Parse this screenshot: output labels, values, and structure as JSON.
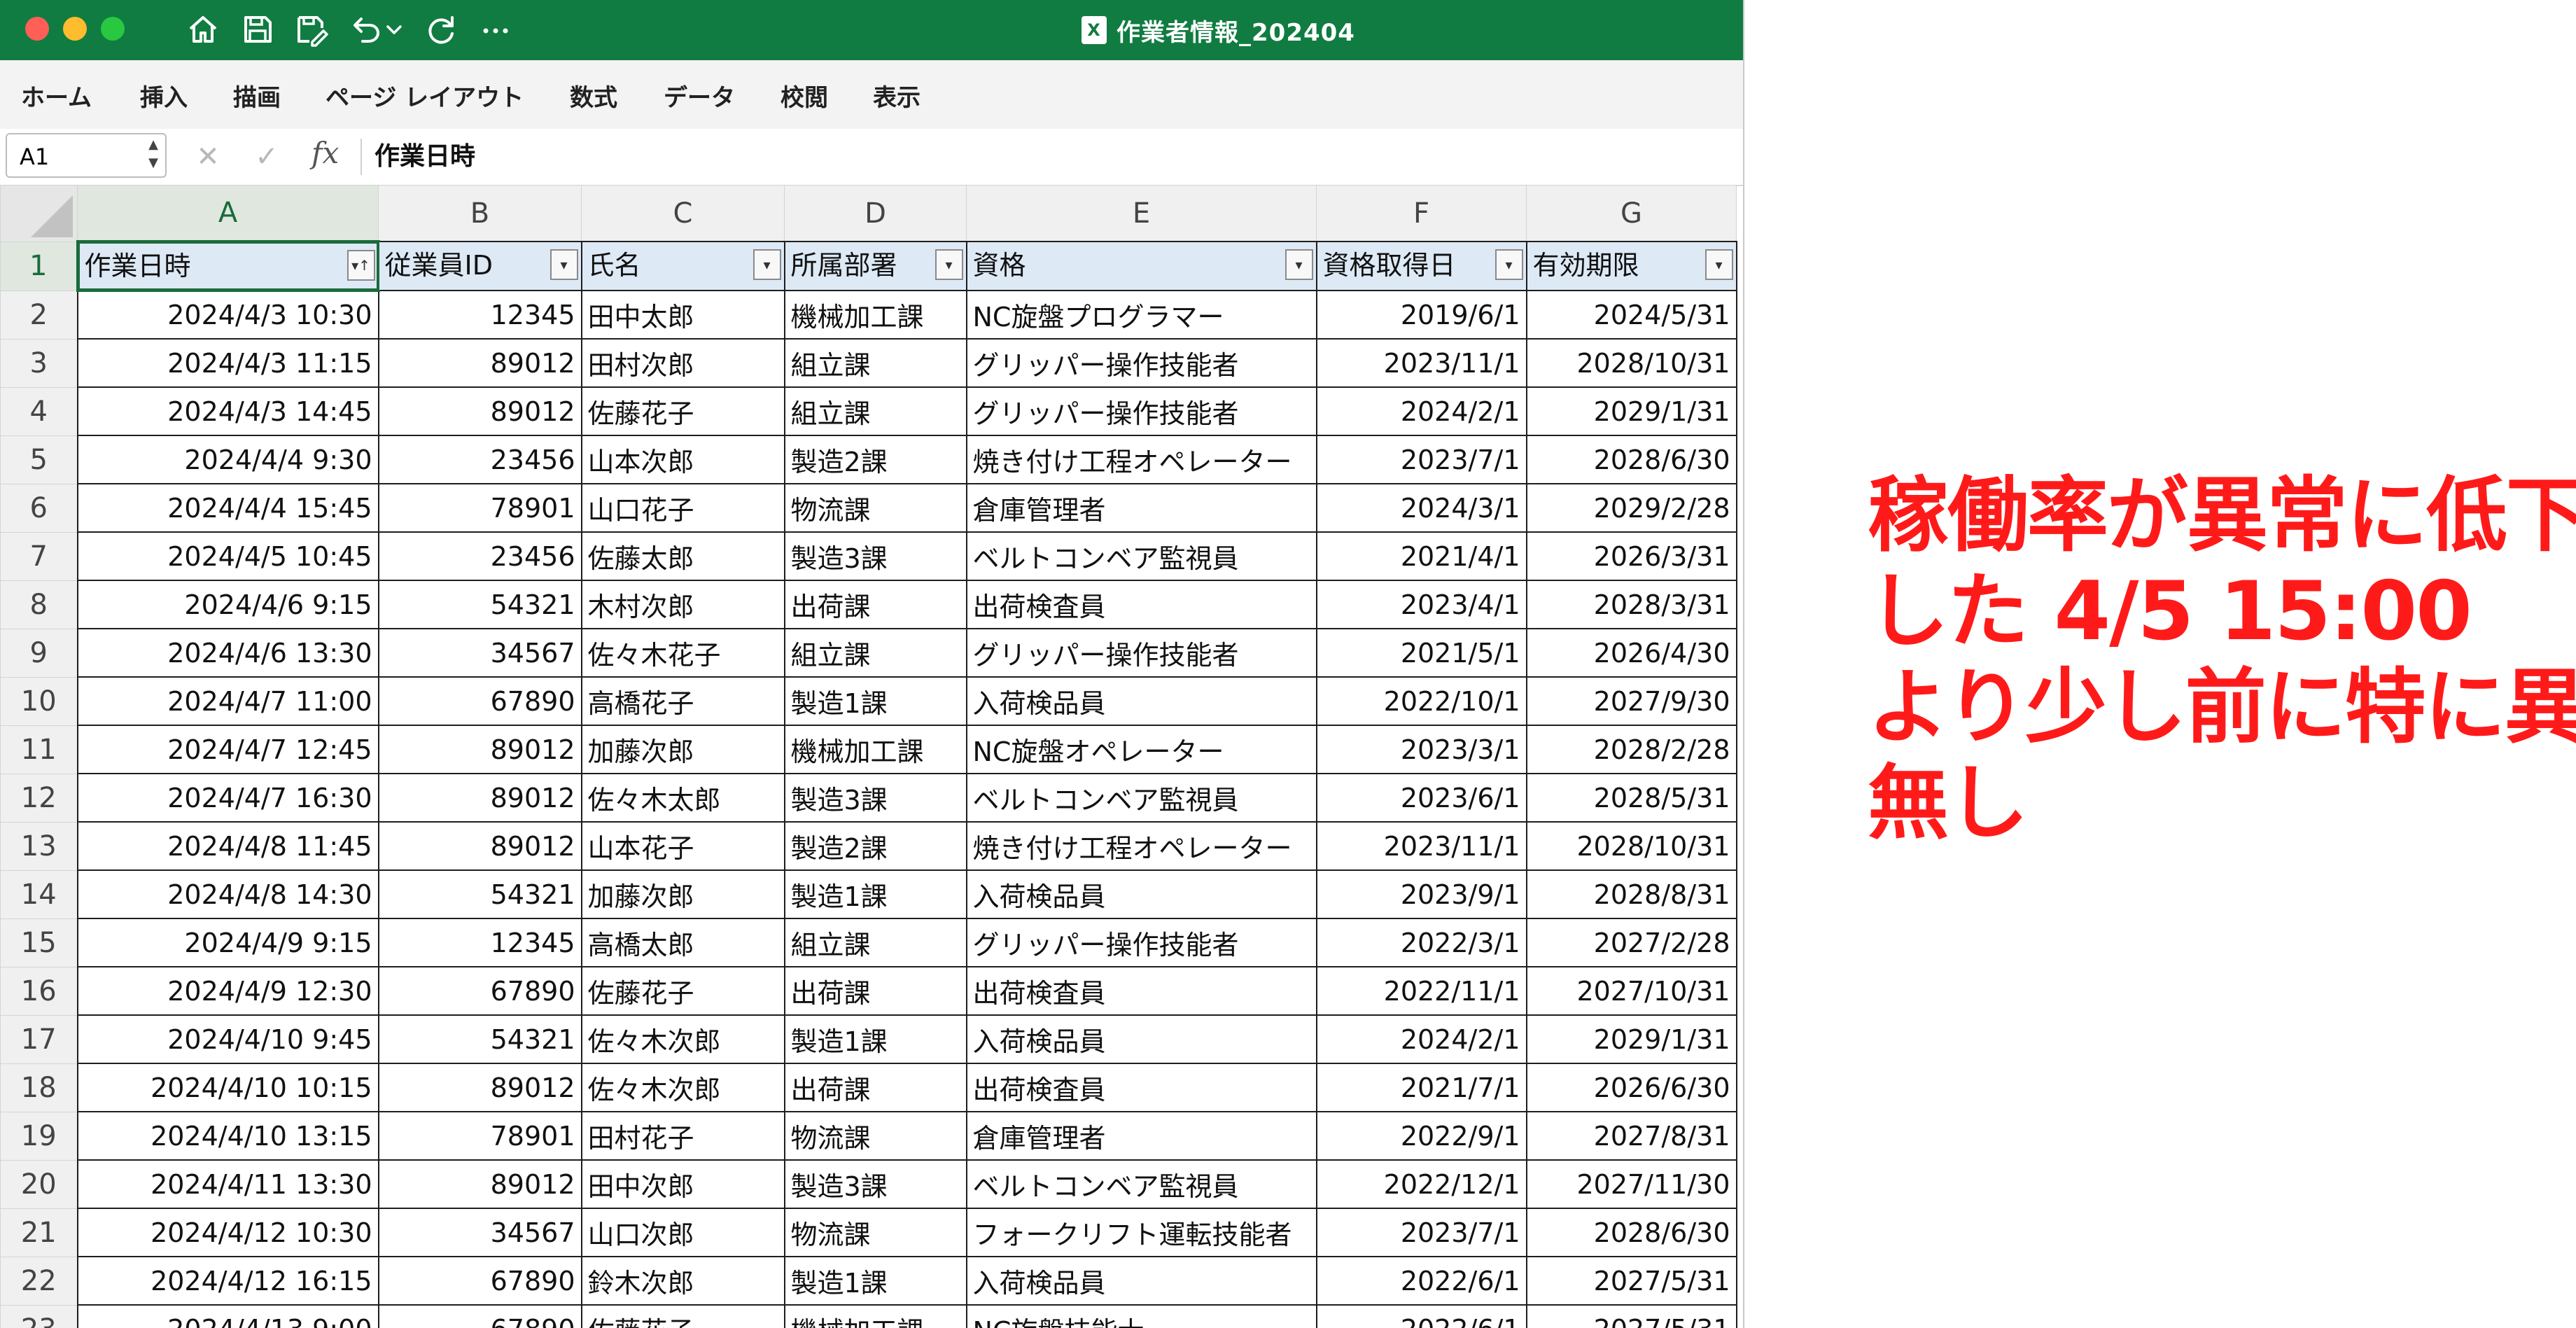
{
  "window": {
    "title": "作業者情報_202404",
    "file_icon_label": "X",
    "traffic_colors": [
      "#ff5f57",
      "#febc2e",
      "#28c840"
    ],
    "accent_color": "#107c41"
  },
  "toolbar_icons": [
    "home-icon",
    "save-icon",
    "save-as-icon",
    "undo-icon",
    "undo-dropdown-icon",
    "redo-icon",
    "more-icon"
  ],
  "ribbon": {
    "tabs": [
      "ホーム",
      "挿入",
      "描画",
      "ページ レイアウト",
      "数式",
      "データ",
      "校閲",
      "表示"
    ]
  },
  "formula_bar": {
    "name_box": "A1",
    "fx": "fx",
    "content": "作業日時"
  },
  "sheet": {
    "column_letters": [
      "A",
      "B",
      "C",
      "D",
      "E",
      "F",
      "G"
    ],
    "headers": [
      "作業日時",
      "従業員ID",
      "氏名",
      "所属部署",
      "資格",
      "資格取得日",
      "有効期限"
    ],
    "rows": [
      {
        "num": "2",
        "cells": [
          "2024/4/3 10:30",
          "12345",
          "田中太郎",
          "機械加工課",
          "NC旋盤プログラマー",
          "2019/6/1",
          "2024/5/31"
        ]
      },
      {
        "num": "3",
        "cells": [
          "2024/4/3 11:15",
          "89012",
          "田村次郎",
          "組立課",
          "グリッパー操作技能者",
          "2023/11/1",
          "2028/10/31"
        ]
      },
      {
        "num": "4",
        "cells": [
          "2024/4/3 14:45",
          "89012",
          "佐藤花子",
          "組立課",
          "グリッパー操作技能者",
          "2024/2/1",
          "2029/1/31"
        ]
      },
      {
        "num": "5",
        "cells": [
          "2024/4/4 9:30",
          "23456",
          "山本次郎",
          "製造2課",
          "焼き付け工程オペレーター",
          "2023/7/1",
          "2028/6/30"
        ]
      },
      {
        "num": "6",
        "cells": [
          "2024/4/4 15:45",
          "78901",
          "山口花子",
          "物流課",
          "倉庫管理者",
          "2024/3/1",
          "2029/2/28"
        ]
      },
      {
        "num": "7",
        "cells": [
          "2024/4/5 10:45",
          "23456",
          "佐藤太郎",
          "製造3課",
          "ベルトコンベア監視員",
          "2021/4/1",
          "2026/3/31"
        ]
      },
      {
        "num": "8",
        "cells": [
          "2024/4/6 9:15",
          "54321",
          "木村次郎",
          "出荷課",
          "出荷検査員",
          "2023/4/1",
          "2028/3/31"
        ]
      },
      {
        "num": "9",
        "cells": [
          "2024/4/6 13:30",
          "34567",
          "佐々木花子",
          "組立課",
          "グリッパー操作技能者",
          "2021/5/1",
          "2026/4/30"
        ]
      },
      {
        "num": "10",
        "cells": [
          "2024/4/7 11:00",
          "67890",
          "高橋花子",
          "製造1課",
          "入荷検品員",
          "2022/10/1",
          "2027/9/30"
        ]
      },
      {
        "num": "11",
        "cells": [
          "2024/4/7 12:45",
          "89012",
          "加藤次郎",
          "機械加工課",
          "NC旋盤オペレーター",
          "2023/3/1",
          "2028/2/28"
        ]
      },
      {
        "num": "12",
        "cells": [
          "2024/4/7 16:30",
          "89012",
          "佐々木太郎",
          "製造3課",
          "ベルトコンベア監視員",
          "2023/6/1",
          "2028/5/31"
        ]
      },
      {
        "num": "13",
        "cells": [
          "2024/4/8 11:45",
          "89012",
          "山本花子",
          "製造2課",
          "焼き付け工程オペレーター",
          "2023/11/1",
          "2028/10/31"
        ]
      },
      {
        "num": "14",
        "cells": [
          "2024/4/8 14:30",
          "54321",
          "加藤次郎",
          "製造1課",
          "入荷検品員",
          "2023/9/1",
          "2028/8/31"
        ]
      },
      {
        "num": "15",
        "cells": [
          "2024/4/9 9:15",
          "12345",
          "高橋太郎",
          "組立課",
          "グリッパー操作技能者",
          "2022/3/1",
          "2027/2/28"
        ]
      },
      {
        "num": "16",
        "cells": [
          "2024/4/9 12:30",
          "67890",
          "佐藤花子",
          "出荷課",
          "出荷検査員",
          "2022/11/1",
          "2027/10/31"
        ]
      },
      {
        "num": "17",
        "cells": [
          "2024/4/10 9:45",
          "54321",
          "佐々木次郎",
          "製造1課",
          "入荷検品員",
          "2024/2/1",
          "2029/1/31"
        ]
      },
      {
        "num": "18",
        "cells": [
          "2024/4/10 10:15",
          "89012",
          "佐々木次郎",
          "出荷課",
          "出荷検査員",
          "2021/7/1",
          "2026/6/30"
        ]
      },
      {
        "num": "19",
        "cells": [
          "2024/4/10 13:15",
          "78901",
          "田村花子",
          "物流課",
          "倉庫管理者",
          "2022/9/1",
          "2027/8/31"
        ]
      },
      {
        "num": "20",
        "cells": [
          "2024/4/11 13:30",
          "89012",
          "田中次郎",
          "製造3課",
          "ベルトコンベア監視員",
          "2022/12/1",
          "2027/11/30"
        ]
      },
      {
        "num": "21",
        "cells": [
          "2024/4/12 10:30",
          "34567",
          "山口次郎",
          "物流課",
          "フォークリフト運転技能者",
          "2023/7/1",
          "2028/6/30"
        ]
      },
      {
        "num": "22",
        "cells": [
          "2024/4/12 16:15",
          "67890",
          "鈴木次郎",
          "製造1課",
          "入荷検品員",
          "2022/6/1",
          "2027/5/31"
        ]
      },
      {
        "num": "23",
        "cells": [
          "2024/4/13 9:00",
          "67890",
          "佐藤花子",
          "機械加工課",
          "NC旋盤技能士",
          "2022/6/1",
          "2027/5/31"
        ]
      }
    ]
  },
  "annotation": {
    "lines": [
      "稼働率が異常に低下",
      "した 4/5 15:00",
      "より少し前に特に異変",
      "無し"
    ],
    "color": "#ff1a1a"
  }
}
